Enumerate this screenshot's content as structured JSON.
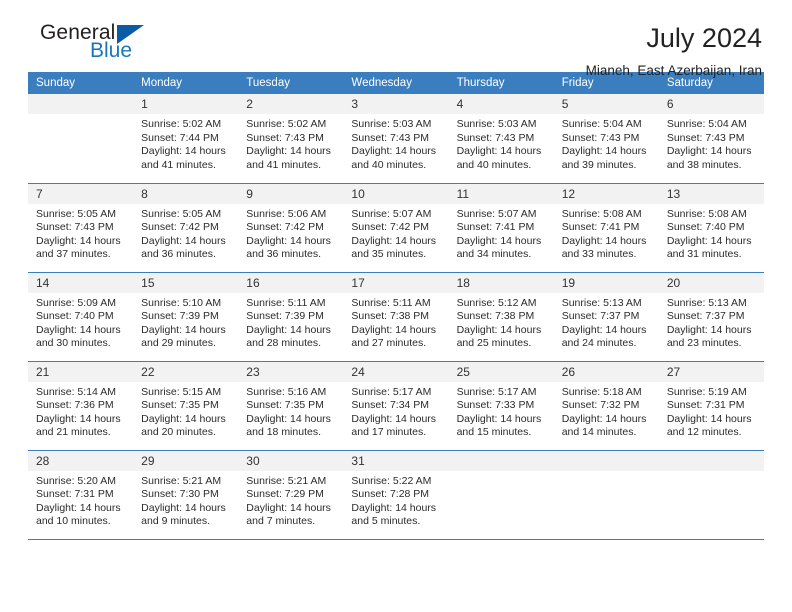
{
  "brand": {
    "name_part1": "General",
    "name_part2": "Blue",
    "triangle_icon": "triangle-icon",
    "colors": {
      "dark": "#231f20",
      "blue": "#1b75bb",
      "triangle": "#0a5ba3"
    }
  },
  "header": {
    "title": "July 2024",
    "subtitle": "Mianeh, East Azerbaijan, Iran"
  },
  "theme": {
    "header_blue": "#3a7ebf",
    "daynum_band": "#f2f2f2",
    "text": "#2b2b2b"
  },
  "calendar": {
    "weekday_headers": [
      "Sunday",
      "Monday",
      "Tuesday",
      "Wednesday",
      "Thursday",
      "Friday",
      "Saturday"
    ],
    "weeks": [
      [
        {
          "day": "",
          "sunrise": "",
          "sunset": "",
          "daylight": ""
        },
        {
          "day": "1",
          "sunrise": "Sunrise: 5:02 AM",
          "sunset": "Sunset: 7:44 PM",
          "daylight": "Daylight: 14 hours and 41 minutes."
        },
        {
          "day": "2",
          "sunrise": "Sunrise: 5:02 AM",
          "sunset": "Sunset: 7:43 PM",
          "daylight": "Daylight: 14 hours and 41 minutes."
        },
        {
          "day": "3",
          "sunrise": "Sunrise: 5:03 AM",
          "sunset": "Sunset: 7:43 PM",
          "daylight": "Daylight: 14 hours and 40 minutes."
        },
        {
          "day": "4",
          "sunrise": "Sunrise: 5:03 AM",
          "sunset": "Sunset: 7:43 PM",
          "daylight": "Daylight: 14 hours and 40 minutes."
        },
        {
          "day": "5",
          "sunrise": "Sunrise: 5:04 AM",
          "sunset": "Sunset: 7:43 PM",
          "daylight": "Daylight: 14 hours and 39 minutes."
        },
        {
          "day": "6",
          "sunrise": "Sunrise: 5:04 AM",
          "sunset": "Sunset: 7:43 PM",
          "daylight": "Daylight: 14 hours and 38 minutes."
        }
      ],
      [
        {
          "day": "7",
          "sunrise": "Sunrise: 5:05 AM",
          "sunset": "Sunset: 7:43 PM",
          "daylight": "Daylight: 14 hours and 37 minutes."
        },
        {
          "day": "8",
          "sunrise": "Sunrise: 5:05 AM",
          "sunset": "Sunset: 7:42 PM",
          "daylight": "Daylight: 14 hours and 36 minutes."
        },
        {
          "day": "9",
          "sunrise": "Sunrise: 5:06 AM",
          "sunset": "Sunset: 7:42 PM",
          "daylight": "Daylight: 14 hours and 36 minutes."
        },
        {
          "day": "10",
          "sunrise": "Sunrise: 5:07 AM",
          "sunset": "Sunset: 7:42 PM",
          "daylight": "Daylight: 14 hours and 35 minutes."
        },
        {
          "day": "11",
          "sunrise": "Sunrise: 5:07 AM",
          "sunset": "Sunset: 7:41 PM",
          "daylight": "Daylight: 14 hours and 34 minutes."
        },
        {
          "day": "12",
          "sunrise": "Sunrise: 5:08 AM",
          "sunset": "Sunset: 7:41 PM",
          "daylight": "Daylight: 14 hours and 33 minutes."
        },
        {
          "day": "13",
          "sunrise": "Sunrise: 5:08 AM",
          "sunset": "Sunset: 7:40 PM",
          "daylight": "Daylight: 14 hours and 31 minutes."
        }
      ],
      [
        {
          "day": "14",
          "sunrise": "Sunrise: 5:09 AM",
          "sunset": "Sunset: 7:40 PM",
          "daylight": "Daylight: 14 hours and 30 minutes."
        },
        {
          "day": "15",
          "sunrise": "Sunrise: 5:10 AM",
          "sunset": "Sunset: 7:39 PM",
          "daylight": "Daylight: 14 hours and 29 minutes."
        },
        {
          "day": "16",
          "sunrise": "Sunrise: 5:11 AM",
          "sunset": "Sunset: 7:39 PM",
          "daylight": "Daylight: 14 hours and 28 minutes."
        },
        {
          "day": "17",
          "sunrise": "Sunrise: 5:11 AM",
          "sunset": "Sunset: 7:38 PM",
          "daylight": "Daylight: 14 hours and 27 minutes."
        },
        {
          "day": "18",
          "sunrise": "Sunrise: 5:12 AM",
          "sunset": "Sunset: 7:38 PM",
          "daylight": "Daylight: 14 hours and 25 minutes."
        },
        {
          "day": "19",
          "sunrise": "Sunrise: 5:13 AM",
          "sunset": "Sunset: 7:37 PM",
          "daylight": "Daylight: 14 hours and 24 minutes."
        },
        {
          "day": "20",
          "sunrise": "Sunrise: 5:13 AM",
          "sunset": "Sunset: 7:37 PM",
          "daylight": "Daylight: 14 hours and 23 minutes."
        }
      ],
      [
        {
          "day": "21",
          "sunrise": "Sunrise: 5:14 AM",
          "sunset": "Sunset: 7:36 PM",
          "daylight": "Daylight: 14 hours and 21 minutes."
        },
        {
          "day": "22",
          "sunrise": "Sunrise: 5:15 AM",
          "sunset": "Sunset: 7:35 PM",
          "daylight": "Daylight: 14 hours and 20 minutes."
        },
        {
          "day": "23",
          "sunrise": "Sunrise: 5:16 AM",
          "sunset": "Sunset: 7:35 PM",
          "daylight": "Daylight: 14 hours and 18 minutes."
        },
        {
          "day": "24",
          "sunrise": "Sunrise: 5:17 AM",
          "sunset": "Sunset: 7:34 PM",
          "daylight": "Daylight: 14 hours and 17 minutes."
        },
        {
          "day": "25",
          "sunrise": "Sunrise: 5:17 AM",
          "sunset": "Sunset: 7:33 PM",
          "daylight": "Daylight: 14 hours and 15 minutes."
        },
        {
          "day": "26",
          "sunrise": "Sunrise: 5:18 AM",
          "sunset": "Sunset: 7:32 PM",
          "daylight": "Daylight: 14 hours and 14 minutes."
        },
        {
          "day": "27",
          "sunrise": "Sunrise: 5:19 AM",
          "sunset": "Sunset: 7:31 PM",
          "daylight": "Daylight: 14 hours and 12 minutes."
        }
      ],
      [
        {
          "day": "28",
          "sunrise": "Sunrise: 5:20 AM",
          "sunset": "Sunset: 7:31 PM",
          "daylight": "Daylight: 14 hours and 10 minutes."
        },
        {
          "day": "29",
          "sunrise": "Sunrise: 5:21 AM",
          "sunset": "Sunset: 7:30 PM",
          "daylight": "Daylight: 14 hours and 9 minutes."
        },
        {
          "day": "30",
          "sunrise": "Sunrise: 5:21 AM",
          "sunset": "Sunset: 7:29 PM",
          "daylight": "Daylight: 14 hours and 7 minutes."
        },
        {
          "day": "31",
          "sunrise": "Sunrise: 5:22 AM",
          "sunset": "Sunset: 7:28 PM",
          "daylight": "Daylight: 14 hours and 5 minutes."
        },
        {
          "day": "",
          "sunrise": "",
          "sunset": "",
          "daylight": ""
        },
        {
          "day": "",
          "sunrise": "",
          "sunset": "",
          "daylight": ""
        },
        {
          "day": "",
          "sunrise": "",
          "sunset": "",
          "daylight": ""
        }
      ]
    ]
  }
}
